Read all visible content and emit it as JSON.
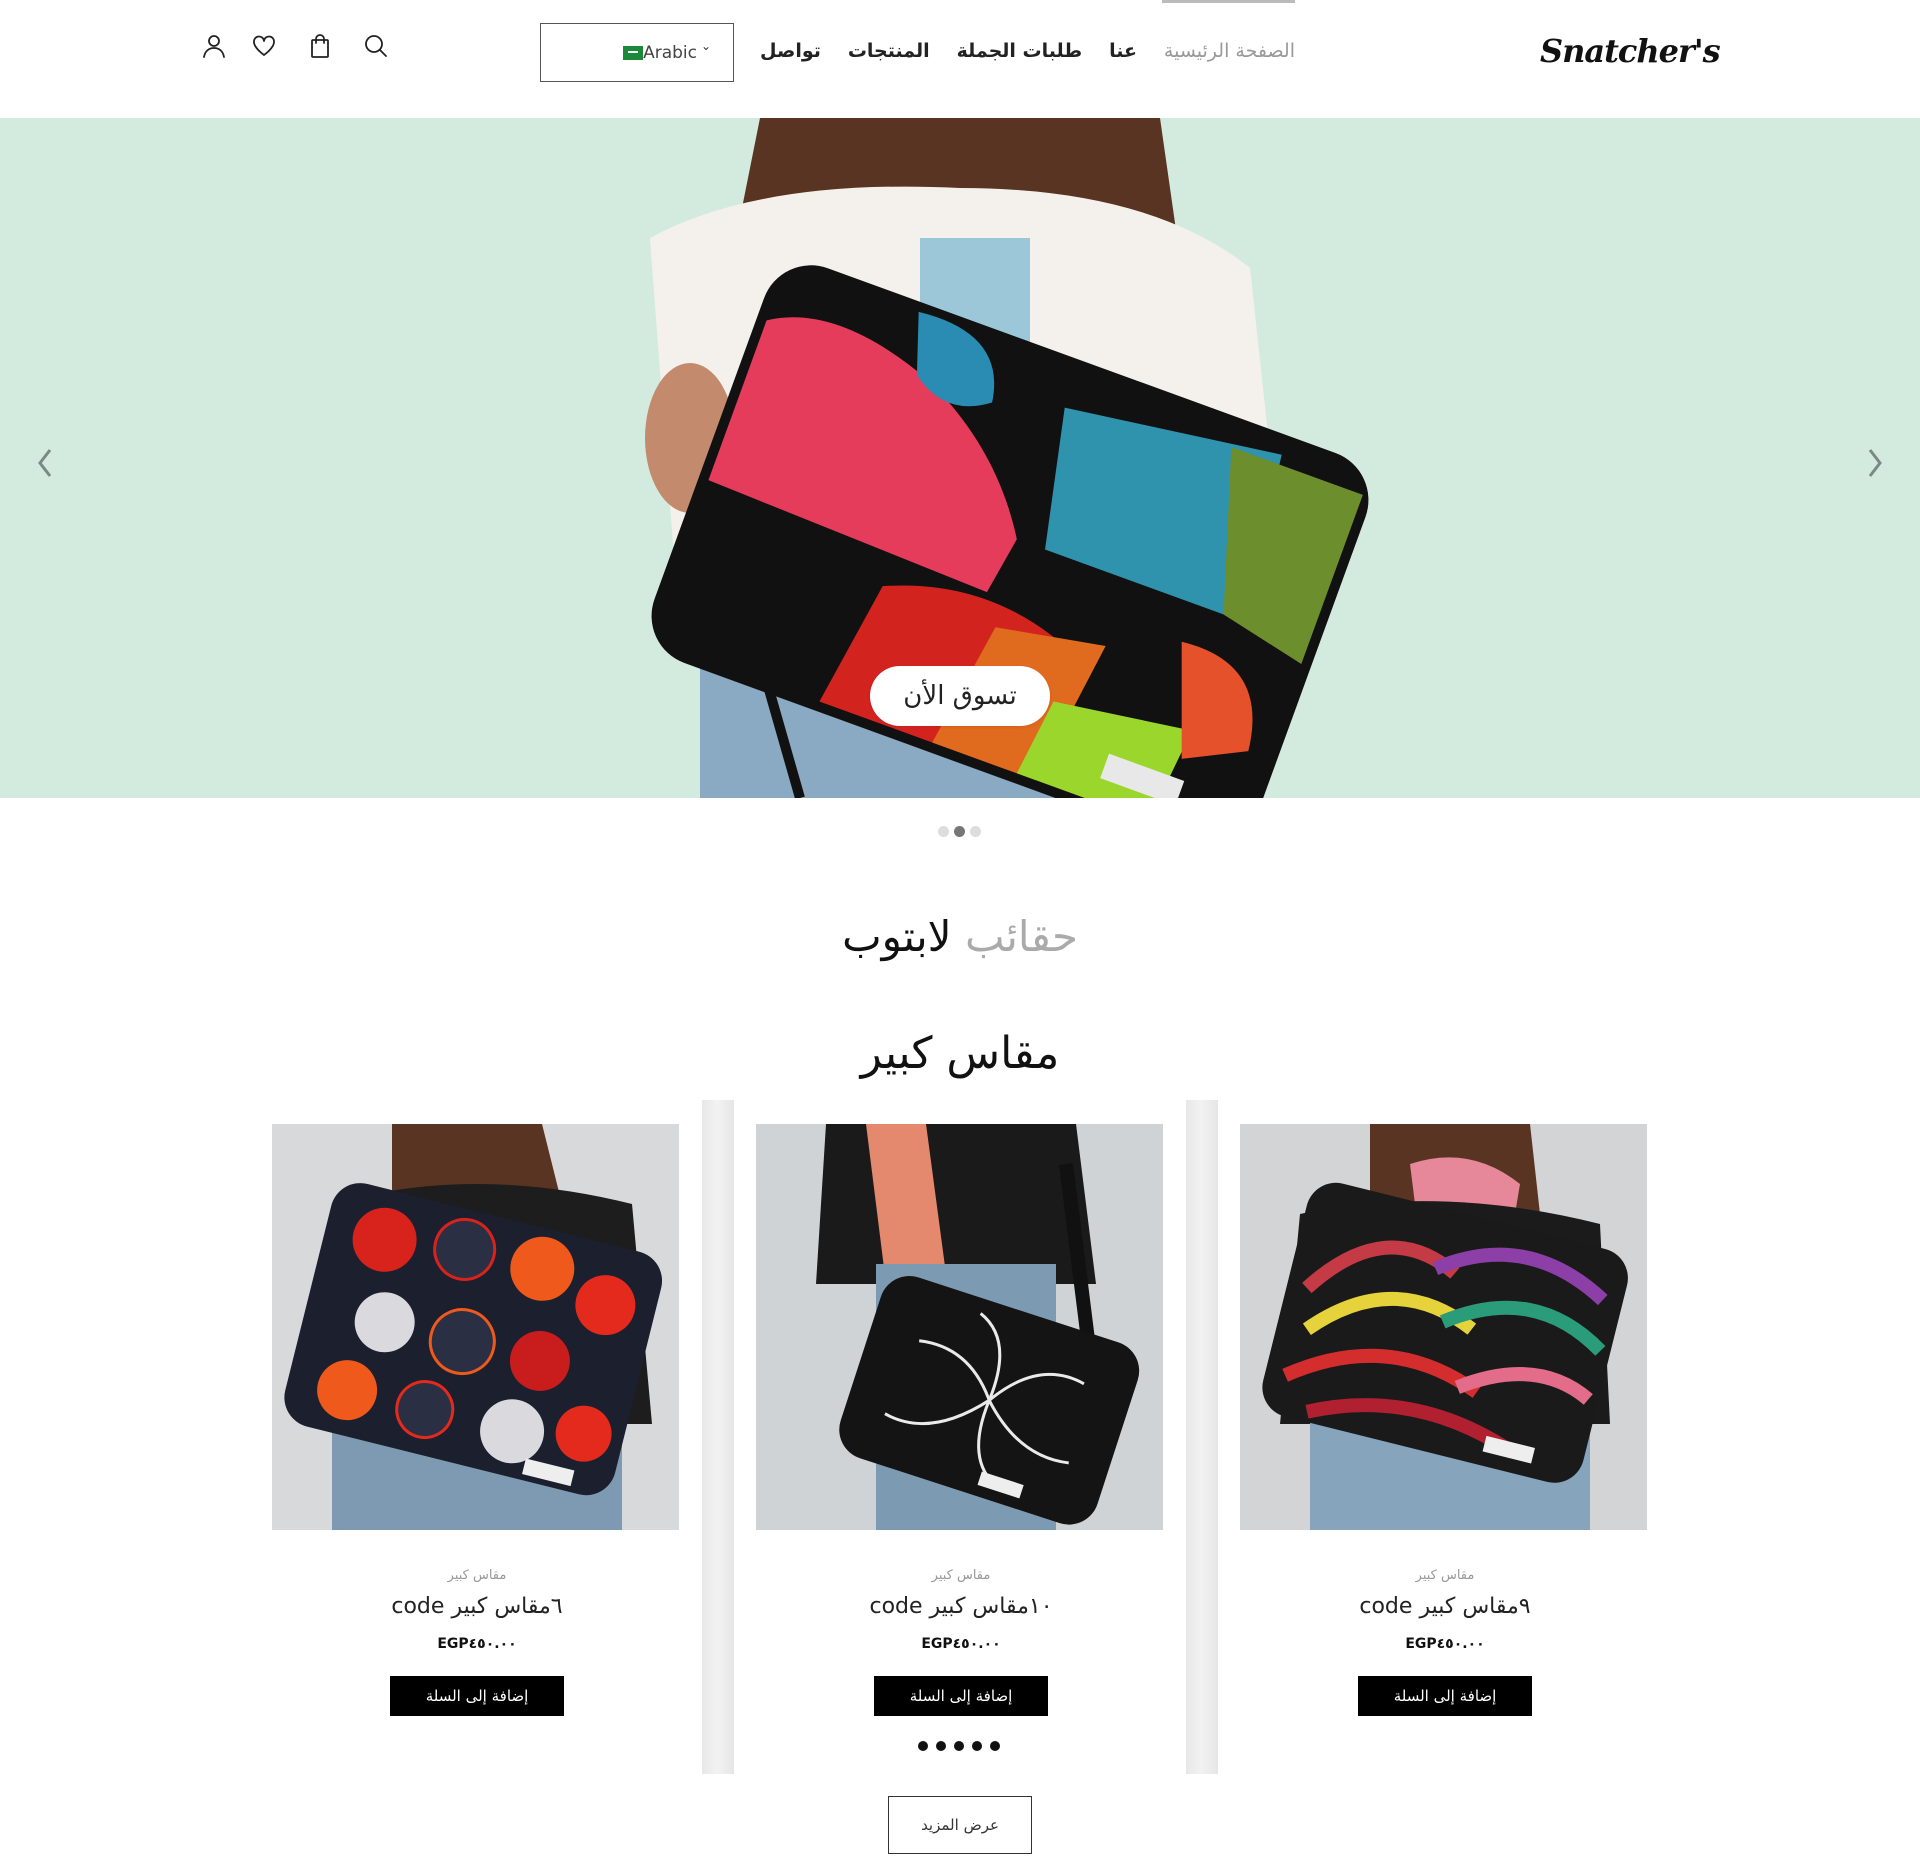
{
  "brand": {
    "logo_text": "Snatcher's"
  },
  "header": {
    "nav": [
      {
        "label": "الصفحة الرئيسية",
        "active": true
      },
      {
        "label": "عنا"
      },
      {
        "label": "طلبات الجملة"
      },
      {
        "label": "المنتجات"
      },
      {
        "label": "تواصل"
      }
    ],
    "language": {
      "label": "Arabic",
      "flag_icon": "saudi-flag-icon"
    },
    "icons": [
      "search-icon",
      "shopping-bag-icon",
      "heart-icon",
      "user-icon"
    ]
  },
  "hero": {
    "cta_label": "تسوق الأن",
    "background": "#d3ebdf",
    "slide_dots": 3,
    "active_slide": 2
  },
  "section": {
    "title_light": "حقائب",
    "title_dark": "لابتوب",
    "subtitle": "مقاس كبير"
  },
  "products": [
    {
      "category": "مقاس كبير",
      "name": "code ٦مقاس كبير",
      "price": "EGP٤٥٠.٠٠",
      "button": "إضافة إلى السلة"
    },
    {
      "category": "مقاس كبير",
      "name": "code ١٠مقاس كبير",
      "price": "EGP٤٥٠.٠٠",
      "button": "إضافة إلى السلة"
    },
    {
      "category": "مقاس كبير",
      "name": "code ٩مقاس كبير",
      "price": "EGP٤٥٠.٠٠",
      "button": "إضافة إلى السلة"
    }
  ],
  "carousel": {
    "dots": 5
  },
  "load_more_label": "عرض المزيد",
  "colors": {
    "accent": "#000000",
    "muted": "#999999",
    "hero_bg": "#d3ebdf"
  }
}
